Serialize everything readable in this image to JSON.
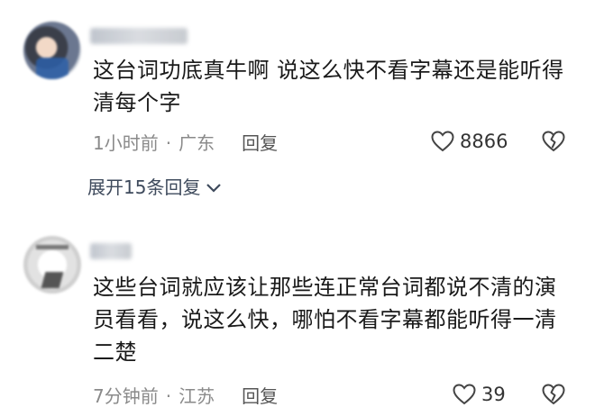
{
  "comments": [
    {
      "text": "这台词功底真牛啊 说这么快不看字幕还是能听得清每个字",
      "time": "1小时前",
      "location": "广东",
      "reply_label": "回复",
      "likes": "8866",
      "expand_label": "展开15条回复"
    },
    {
      "text": "这些台词就应该让那些连正常台词都说不清的演员看看，说这么快，哪怕不看字幕都能听得一清二楚",
      "time": "7分钟前",
      "location": "江苏",
      "reply_label": "回复",
      "likes": "39"
    }
  ],
  "separator": "·",
  "icons": {
    "like": "heart-outline-icon",
    "dislike": "broken-heart-icon",
    "expand": "chevron-down-icon"
  },
  "colors": {
    "text": "#1a1a1a",
    "meta": "#8a8a8a",
    "expand": "#3e4a5c"
  }
}
